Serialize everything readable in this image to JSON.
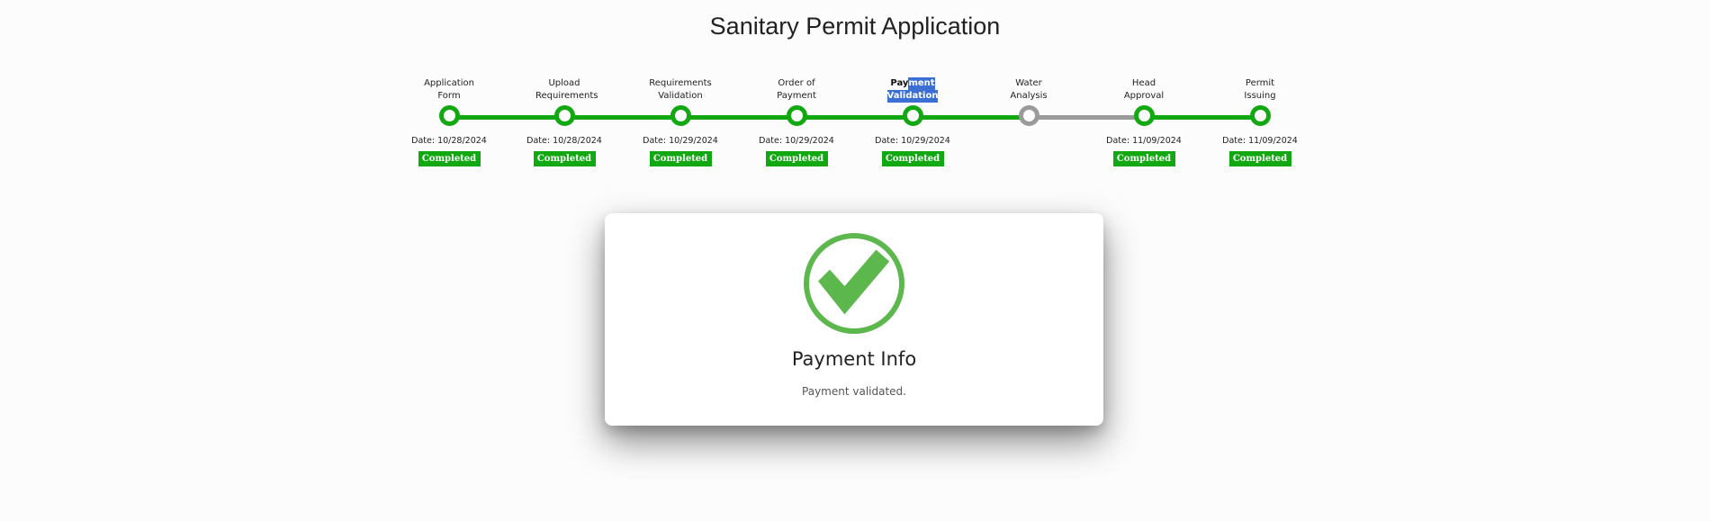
{
  "page": {
    "title": "Sanitary Permit Application"
  },
  "colors": {
    "completed": "#12a812",
    "pending": "#9a9a9a",
    "check": "#5cb84c"
  },
  "steps": [
    {
      "label": "Application Form",
      "date": "Date: 10/28/2024",
      "status": "Completed",
      "state": "completed"
    },
    {
      "label": "Upload Requirements",
      "date": "Date: 10/28/2024",
      "status": "Completed",
      "state": "completed"
    },
    {
      "label": "Requirements Validation",
      "date": "Date: 10/29/2024",
      "status": "Completed",
      "state": "completed"
    },
    {
      "label": "Order of Payment",
      "date": "Date: 10/29/2024",
      "status": "Completed",
      "state": "completed"
    },
    {
      "label_part1": "Pay",
      "label_part2": "ment",
      "label_part3": "Validation",
      "date": "Date: 10/29/2024",
      "status": "Completed",
      "state": "current"
    },
    {
      "label": "Water Analysis",
      "date": "",
      "status": "",
      "state": "pending"
    },
    {
      "label": "Head Approval",
      "date": "Date: 11/09/2024",
      "status": "Completed",
      "state": "completed"
    },
    {
      "label": "Permit Issuing",
      "date": "Date: 11/09/2024",
      "status": "Completed",
      "state": "completed"
    }
  ],
  "card": {
    "icon": "check-circle-icon",
    "title": "Payment Info",
    "message": "Payment validated."
  }
}
